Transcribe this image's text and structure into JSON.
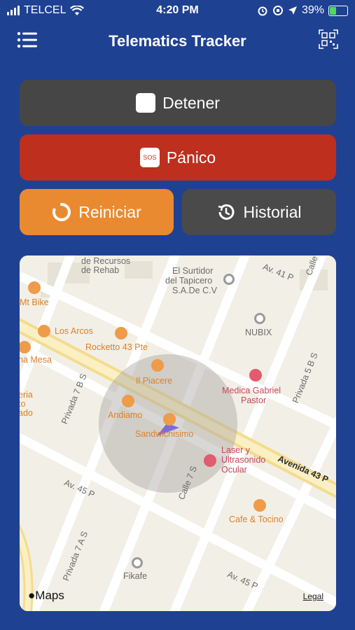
{
  "status_bar": {
    "carrier": "TELCEL",
    "time": "4:20 PM",
    "battery": "39%"
  },
  "nav": {
    "title": "Telematics Tracker"
  },
  "buttons": {
    "stop": "Detener",
    "panic": "Pánico",
    "sos_badge": "SOS",
    "restart": "Reiniciar",
    "history": "Historial"
  },
  "map": {
    "labels": {
      "l1": "de Recursos",
      "l2": "de Rehab",
      "l3": "El Surtidor",
      "l4": "del Tapicero",
      "l5": "S.A.De C.V",
      "l6": "Av. 41 P",
      "l7": "Mt Bike",
      "l8": "Los Arcos",
      "l9": "Rocketto 43 Pte",
      "l10": "NUBIX",
      "l11": "na Mesa",
      "l12": "Il Piacere",
      "l13": "Medica Gabriel",
      "l14": "Pastor",
      "l15": "eria",
      "l16": "to",
      "l17": "ado",
      "l18": "Privada 7 B S",
      "l19": "Andiamo",
      "l20": "Sandwichisimo",
      "l21": "Privada 5 B S",
      "l22": "Laser y",
      "l23": "Ultrasonido",
      "l24": "Ocular",
      "l25": "Avenida 43 P",
      "l26": "Av. 45 P",
      "l27": "Calle 7 S",
      "l28": "Cafe & Tocino",
      "l29": "Privada 7 A S",
      "l30": "Fikafe",
      "l31": "Av. 45 P",
      "l32": "Calle"
    },
    "brand": "Maps",
    "legal": "Legal"
  },
  "colors": {
    "background": "#1f4192",
    "stop": "#464646",
    "panic": "#be2f1e",
    "restart": "#ea8a30",
    "history": "#4a4a4a"
  }
}
